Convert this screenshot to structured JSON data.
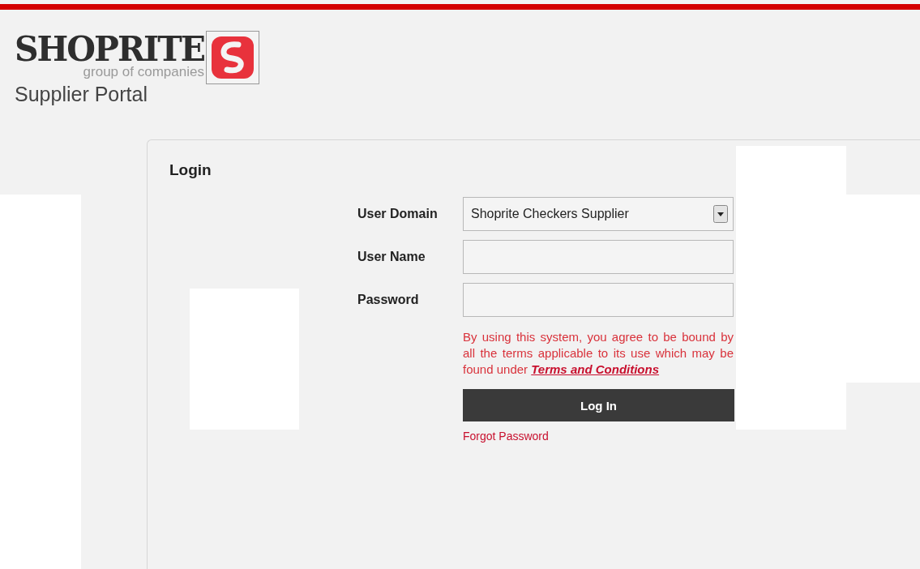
{
  "logo": {
    "wordmark": "SHOPRITE",
    "tagline": "group of companies"
  },
  "portal_title": "Supplier Portal",
  "login": {
    "title": "Login",
    "fields": [
      {
        "kind": "select",
        "label": "User Domain",
        "value": "Shoprite Checkers Supplier"
      },
      {
        "kind": "text",
        "label": "User Name"
      },
      {
        "kind": "password",
        "label": "Password"
      }
    ],
    "notice": "By using this system, you agree to be bound by all the terms applicable to its use which may be found under",
    "notice_link": "Terms and Conditions",
    "submit": "Log In",
    "forgot": "Forgot Password"
  }
}
